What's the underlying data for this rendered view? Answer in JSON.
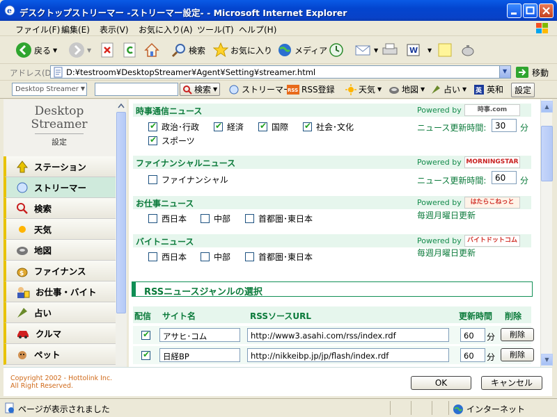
{
  "window": {
    "title": "デスクトップストリーマー -ストリーマー設定- - Microsoft Internet Explorer"
  },
  "menu": [
    "ファイル(F)",
    "編集(E)",
    "表示(V)",
    "お気に入り(A)",
    "ツール(T)",
    "ヘルプ(H)"
  ],
  "toolbar": {
    "back": "戻る",
    "search": "検索",
    "favorites": "お気に入り",
    "media": "メディア"
  },
  "address": {
    "label": "アドレス(D)",
    "url": "D:¥testroom¥DesktopStreamer¥Agent¥Setting¥streamer.html",
    "go": "移動"
  },
  "cbar": {
    "select": "Desktop Streamer",
    "search": "検索",
    "streamer": "ストリーマー",
    "rss": "RSS登録",
    "weather": "天気",
    "map": "地図",
    "fortune": "占い",
    "dict": "英和",
    "settings": "設定"
  },
  "sidebar": {
    "logo_line1": "Desktop",
    "logo_line2": "Streamer",
    "logo_sub": "設定",
    "items": [
      "ステーション",
      "ストリーマー",
      "検索",
      "天気",
      "地図",
      "ファイナンス",
      "お仕事・バイト",
      "占い",
      "クルマ",
      "ペット"
    ]
  },
  "sections": {
    "jiji": {
      "title": "時事通信ニュース",
      "powered": "Powered by",
      "options": [
        {
          "label": "政治･行政",
          "checked": true
        },
        {
          "label": "経済",
          "checked": true
        },
        {
          "label": "国際",
          "checked": true
        },
        {
          "label": "社会･文化",
          "checked": true
        },
        {
          "label": "スポーツ",
          "checked": true
        }
      ],
      "interval_label": "ニュース更新時間:",
      "interval": "30",
      "unit": "分",
      "logo": "時事.com"
    },
    "finance": {
      "title": "ファイナンシャルニュース",
      "powered": "Powered by",
      "options": [
        {
          "label": "ファイナンシャル",
          "checked": false
        }
      ],
      "interval_label": "ニュース更新時間:",
      "interval": "60",
      "unit": "分",
      "logo": "MORNINGSTAR"
    },
    "work": {
      "title": "お仕事ニュース",
      "powered": "Powered by",
      "options": [
        {
          "label": "西日本"
        },
        {
          "label": "中部"
        },
        {
          "label": "首都圏･東日本"
        }
      ],
      "note": "毎週月曜日更新",
      "logo": "はたらこねっと"
    },
    "part": {
      "title": "バイトニュース",
      "powered": "Powered by",
      "options": [
        {
          "label": "西日本"
        },
        {
          "label": "中部"
        },
        {
          "label": "首都圏･東日本"
        }
      ],
      "note": "毎週月曜日更新",
      "logo": "バイトドットコム"
    }
  },
  "rss": {
    "title": "RSSニュースジャンルの選択",
    "headers": {
      "deliver": "配信",
      "site": "サイト名",
      "url": "RSSソースURL",
      "interval": "更新時間",
      "delete": "削除"
    },
    "rows": [
      {
        "site": "アサヒ･コム",
        "url": "http://www3.asahi.com/rss/index.rdf",
        "interval": "60",
        "unit": "分",
        "delete": "削除"
      },
      {
        "site": "日経BP",
        "url": "http://nikkeibp.jp/jp/flash/index.rdf",
        "interval": "60",
        "unit": "分",
        "delete": "削除"
      }
    ]
  },
  "footer": {
    "copy1": "Copyright 2002 - Hottolink Inc.",
    "copy2": "All Right Reserved.",
    "ok": "OK",
    "cancel": "キャンセル"
  },
  "status": {
    "message": "ページが表示されました",
    "zone": "インターネット"
  }
}
